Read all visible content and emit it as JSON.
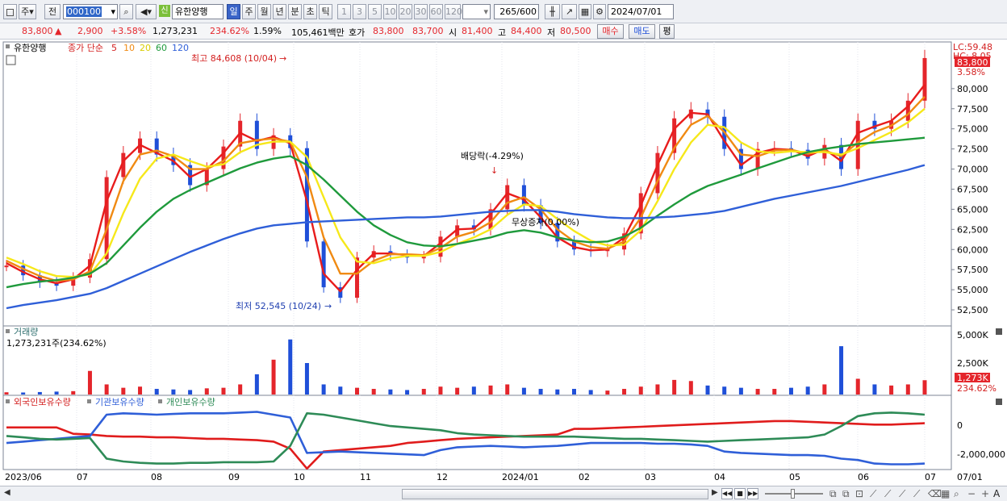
{
  "toolbar": {
    "period_ju": "주",
    "period_jeon": "전",
    "stock_code": "000100",
    "sin_badge": "신",
    "stock_name": "유한양행",
    "periods": [
      "일",
      "주",
      "월",
      "년",
      "분",
      "초",
      "틱"
    ],
    "selected_period": "일",
    "intervals": [
      "1",
      "3",
      "5",
      "10",
      "20",
      "30",
      "60",
      "120"
    ],
    "count_value": "265",
    "count_total": "/600",
    "date_value": "2024/07/01"
  },
  "quote": {
    "price": "83,800",
    "arrow": "▲",
    "change": "2,900",
    "change_pct": "+3.58%",
    "volume": "1,273,231",
    "volume_ratio": "234.62%",
    "turnover": "1.59%",
    "amount": "105,461백만",
    "hoga_label": "호가",
    "ask": "83,800",
    "bid": "83,700",
    "open_label": "시",
    "open": "81,400",
    "high_label": "고",
    "high": "84,400",
    "low_label": "저",
    "low": "80,500",
    "buy_button": "매수",
    "sell_button": "매도",
    "eval_button": "평"
  },
  "price_panel": {
    "title": "유한양행",
    "ma_label": "종가 단순",
    "ma_periods": [
      "5",
      "10",
      "20",
      "60",
      "120"
    ],
    "ma_colors": [
      "#e81c1c",
      "#f08a12",
      "#f6e81a",
      "#1f9a3c",
      "#2f5fd8"
    ],
    "lc_label": "LC:59.48",
    "hc_label": "HC: 8.05",
    "current_price_label": "83,800",
    "current_pct_label": "3.58%",
    "y_ticks": [
      "80,000",
      "77,500",
      "75,000",
      "72,500",
      "70,000",
      "67,500",
      "65,000",
      "62,500",
      "60,000",
      "57,500",
      "55,000",
      "52,500"
    ],
    "annotation_high": "최고 84,608 (10/04)",
    "annotation_low": "최저 52,545 (10/24)",
    "annotation_dividend": "배당락(-4.29%)",
    "annotation_bonus": "무상증자(0.00%)"
  },
  "volume_panel": {
    "title": "거래량",
    "value_label": "1,273,231주(234.62%)",
    "y_ticks": [
      "5,000K",
      "2,500K"
    ],
    "current_label": "1,273K",
    "current_pct": "234.62%"
  },
  "holding_panel": {
    "series_labels": [
      "외국인보유수량",
      "기관보유수량",
      "개인보유수량"
    ],
    "y_ticks": [
      "0",
      "-2,000,000"
    ]
  },
  "x_axis": {
    "labels": [
      "2023/06",
      "07",
      "08",
      "09",
      "10",
      "11",
      "12",
      "2024/01",
      "02",
      "03",
      "04",
      "05",
      "06",
      "07"
    ],
    "right_label": "07/01"
  },
  "colors": {
    "up": "#e4252b",
    "down": "#1f4fd8",
    "foreign": "#e01c1c",
    "institution": "#2f5fd8",
    "individual": "#2e8b57"
  },
  "chart_data": [
    {
      "type": "line",
      "title": "",
      "series": [
        {
          "name": "종가",
          "values": [
            58000,
            56800,
            55900,
            55500,
            56500,
            58800,
            69000,
            72000,
            73800,
            71800,
            70500,
            68000,
            70000,
            72800,
            76000,
            72500,
            74200,
            72600,
            61000,
            55300,
            54000,
            59000,
            59800,
            59300,
            59000,
            59100,
            61600,
            63000,
            62500,
            65000,
            68000,
            65500,
            63300,
            61000,
            60000,
            59800,
            60000,
            62000,
            67000,
            72000,
            76300,
            77400,
            76500,
            72500,
            70000,
            72500,
            72600,
            72400,
            71300,
            73000,
            70000,
            76000,
            75000,
            76000,
            78500,
            83800
          ]
        },
        {
          "name": "5",
          "values": [
            58300,
            57200,
            56300,
            55800,
            56300,
            58000,
            66000,
            71000,
            73000,
            72000,
            71000,
            69000,
            70000,
            72000,
            74500,
            73500,
            74000,
            73200,
            66000,
            57000,
            54800,
            57500,
            59500,
            59500,
            59300,
            59200,
            60800,
            62500,
            62600,
            64400,
            67000,
            66200,
            64000,
            61500,
            60300,
            59900,
            60000,
            61500,
            65500,
            70500,
            75000,
            77000,
            76800,
            73500,
            70500,
            72000,
            72500,
            72400,
            71600,
            72500,
            71000,
            74500,
            75300,
            76000,
            77800,
            80500
          ]
        },
        {
          "name": "10",
          "values": [
            58600,
            57600,
            56700,
            56100,
            56300,
            57300,
            62500,
            68500,
            71800,
            72300,
            71600,
            70000,
            70000,
            71000,
            73200,
            73600,
            73800,
            73400,
            69000,
            61500,
            57000,
            57000,
            58600,
            59400,
            59400,
            59300,
            60200,
            61600,
            62200,
            63400,
            65800,
            66500,
            65000,
            62500,
            61000,
            60300,
            60100,
            61000,
            64000,
            68500,
            72600,
            75500,
            76600,
            74600,
            71800,
            71600,
            72300,
            72400,
            71900,
            72300,
            71600,
            73300,
            74600,
            75400,
            76800,
            79000
          ]
        },
        {
          "name": "20",
          "values": [
            59000,
            58200,
            57300,
            56700,
            56600,
            56900,
            59500,
            64500,
            68800,
            71300,
            71800,
            71000,
            70300,
            70600,
            72100,
            73000,
            73400,
            73400,
            71500,
            66500,
            61500,
            58500,
            58300,
            58900,
            59200,
            59200,
            59700,
            60700,
            61500,
            62500,
            64300,
            65600,
            65400,
            63800,
            62300,
            61100,
            60500,
            60600,
            62400,
            66000,
            70000,
            73300,
            75500,
            75200,
            73300,
            72200,
            72000,
            72200,
            72100,
            72100,
            71800,
            72600,
            73600,
            74600,
            75800,
            77500
          ]
        },
        {
          "name": "60",
          "values": [
            55300,
            55700,
            56000,
            56200,
            56500,
            57000,
            58300,
            60500,
            62700,
            64700,
            66300,
            67400,
            68300,
            69200,
            70100,
            70800,
            71300,
            71600,
            70500,
            68700,
            66700,
            64700,
            63000,
            61800,
            60900,
            60500,
            60400,
            60700,
            61100,
            61500,
            62100,
            62400,
            62100,
            61500,
            61100,
            60900,
            61000,
            61600,
            62700,
            64200,
            65600,
            66900,
            67900,
            68600,
            69300,
            70100,
            70800,
            71500,
            72100,
            72500,
            72800,
            73100,
            73300,
            73500,
            73700,
            73900
          ]
        },
        {
          "name": "120",
          "values": [
            52700,
            53100,
            53400,
            53700,
            54100,
            54500,
            55200,
            56100,
            57000,
            57900,
            58800,
            59700,
            60500,
            61300,
            62000,
            62600,
            63000,
            63200,
            63400,
            63500,
            63600,
            63700,
            63800,
            63900,
            64000,
            64000,
            64100,
            64300,
            64500,
            64700,
            64800,
            64900,
            64900,
            64700,
            64400,
            64200,
            64000,
            63900,
            63900,
            64000,
            64100,
            64300,
            64500,
            64800,
            65300,
            65800,
            66300,
            66700,
            67100,
            67500,
            67900,
            68400,
            68900,
            69400,
            69900,
            70500
          ]
        }
      ],
      "ylim": [
        51000,
        85500
      ],
      "annotations": [
        {
          "text": "최고 84,608 (10/04)",
          "value": 84608
        },
        {
          "text": "최저 52,545 (10/24)",
          "value": 52545
        },
        {
          "text": "배당락(-4.29%)"
        },
        {
          "text": "무상증자(0.00%)"
        }
      ]
    },
    {
      "type": "bar",
      "title": "거래량",
      "values": [
        200,
        180,
        220,
        260,
        300,
        2100,
        900,
        600,
        700,
        500,
        450,
        400,
        550,
        600,
        900,
        1800,
        3100,
        4900,
        2800,
        900,
        700,
        600,
        500,
        450,
        400,
        500,
        700,
        600,
        700,
        800,
        900,
        600,
        500,
        450,
        500,
        400,
        350,
        500,
        700,
        900,
        1300,
        1200,
        800,
        700,
        600,
        500,
        500,
        600,
        700,
        900,
        4300,
        1400,
        900,
        800,
        900,
        1273
      ],
      "ylim": [
        0,
        5600
      ]
    },
    {
      "type": "line",
      "title": "",
      "series": [
        {
          "name": "외국인보유수량",
          "values": [
            100000,
            100000,
            100000,
            100000,
            -350000,
            -400000,
            -500000,
            -550000,
            -550000,
            -600000,
            -600000,
            -650000,
            -700000,
            -700000,
            -750000,
            -800000,
            -900000,
            -1400000,
            -2800000,
            -1600000,
            -1500000,
            -1400000,
            -1300000,
            -1200000,
            -1000000,
            -900000,
            -800000,
            -700000,
            -650000,
            -600000,
            -550000,
            -500000,
            -450000,
            -400000,
            0,
            0,
            50000,
            100000,
            150000,
            200000,
            250000,
            300000,
            350000,
            400000,
            450000,
            500000,
            550000,
            550000,
            500000,
            450000,
            400000,
            350000,
            300000,
            300000,
            350000,
            400000
          ]
        },
        {
          "name": "기관보유수량",
          "values": [
            -1000000,
            -900000,
            -800000,
            -700000,
            -600000,
            -500000,
            1000000,
            1100000,
            1050000,
            1000000,
            1050000,
            1100000,
            1100000,
            1100000,
            1150000,
            1200000,
            1000000,
            800000,
            -1700000,
            -1650000,
            -1600000,
            -1650000,
            -1700000,
            -1750000,
            -1800000,
            -1850000,
            -1500000,
            -1300000,
            -1250000,
            -1200000,
            -1250000,
            -1300000,
            -1250000,
            -1200000,
            -1100000,
            -1000000,
            -1000000,
            -1000000,
            -1000000,
            -1050000,
            -1050000,
            -1100000,
            -1200000,
            -1600000,
            -1700000,
            -1750000,
            -1800000,
            -1850000,
            -1850000,
            -1900000,
            -2100000,
            -2200000,
            -2450000,
            -2500000,
            -2500000,
            -2450000
          ]
        },
        {
          "name": "개인보유수량",
          "values": [
            -500000,
            -600000,
            -700000,
            -750000,
            -700000,
            -650000,
            -2100000,
            -2300000,
            -2400000,
            -2450000,
            -2450000,
            -2400000,
            -2400000,
            -2350000,
            -2350000,
            -2350000,
            -2300000,
            -1200000,
            1100000,
            1000000,
            800000,
            600000,
            400000,
            200000,
            100000,
            0,
            -100000,
            -300000,
            -400000,
            -450000,
            -500000,
            -550000,
            -550000,
            -550000,
            -550000,
            -600000,
            -650000,
            -700000,
            -700000,
            -750000,
            -800000,
            -850000,
            -900000,
            -850000,
            -800000,
            -750000,
            -700000,
            -650000,
            -600000,
            -400000,
            200000,
            900000,
            1100000,
            1150000,
            1100000,
            1000000
          ]
        }
      ],
      "ylim": [
        -2700000,
        1400000
      ]
    }
  ]
}
